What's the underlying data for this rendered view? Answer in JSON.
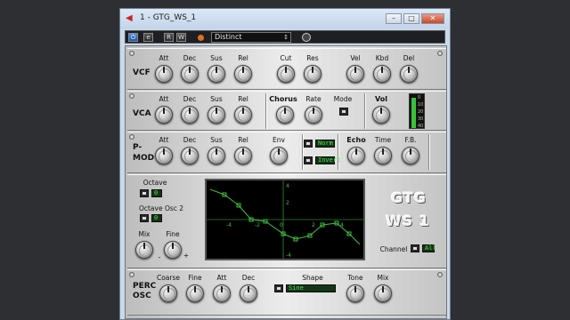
{
  "window": {
    "title": "1 - GTG_WS_1",
    "minimize": "–",
    "maximize": "□",
    "close": "✕"
  },
  "toolbar": {
    "power_label": "⏻",
    "e_label": "e",
    "r_label": "R",
    "w_label": "W",
    "preset": "Distinct",
    "preset_arrows": "↕"
  },
  "vcf": {
    "label": "VCF",
    "knobs": [
      "Att",
      "Dec",
      "Sus",
      "Rel",
      "Cut",
      "Res",
      "Vel",
      "Kbd",
      "Del"
    ]
  },
  "vca": {
    "label": "VCA",
    "knobs": [
      "Att",
      "Dec",
      "Sus",
      "Rel"
    ],
    "chorus": "Chorus",
    "rate": "Rate",
    "mode": "Mode",
    "vol": "Vol",
    "meter_ticks": [
      "0",
      "10",
      "20",
      "30",
      "40"
    ]
  },
  "pmod": {
    "label": "P-\nMOD",
    "label1": "P-",
    "label2": "MOD",
    "knobs": [
      "Att",
      "Dec",
      "Sus",
      "Rel",
      "Env"
    ],
    "norm": "Norm",
    "invert": "Invert",
    "echo": "Echo",
    "time": "Time",
    "fb": "F.B."
  },
  "osc": {
    "octave": "Octave",
    "octave_value": "0",
    "octave2": "Octave Osc 2",
    "octave2_value": "0",
    "mix": "Mix",
    "fine": "Fine",
    "minus": "-",
    "plus": "+"
  },
  "graph": {
    "tick_left": "-4",
    "tick_neg2": "-2",
    "tick_0": "0",
    "tick_2": "2",
    "tick_4": "4",
    "tick_top": "4",
    "tick_mid": "2",
    "tick_bot": "-4"
  },
  "logo": {
    "line1": "GTG",
    "line2": "WS 1"
  },
  "channel": {
    "label": "Channel",
    "value": "All"
  },
  "perc": {
    "label1": "PERC",
    "label2": "OSC",
    "knobs": [
      "Coarse",
      "Fine",
      "Att",
      "Dec"
    ],
    "shape": "Shape",
    "shape_value": "Sine",
    "tone": "Tone",
    "mix": "Mix"
  },
  "colors": {
    "lcd_green": "#4ee05a",
    "graph_line": "#3ec13e",
    "record": "#e07020"
  }
}
